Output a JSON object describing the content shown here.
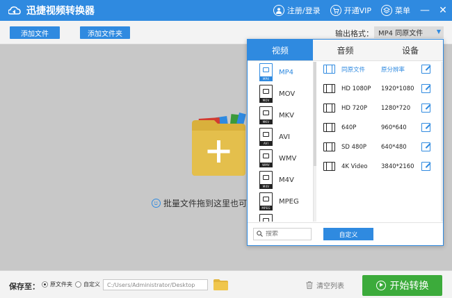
{
  "app": {
    "title": "迅捷视频转换器",
    "register_login": "注册/登录",
    "open_vip": "开通VIP",
    "menu": "菜单",
    "minimize": "—",
    "close": "✕"
  },
  "toolbar": {
    "add_file": "添加文件",
    "add_folder": "添加文件夹",
    "output_format_label": "输出格式：",
    "output_format_value": "MP4  同原文件"
  },
  "main": {
    "hint": "批量文件拖到这里也可"
  },
  "popup": {
    "tabs": [
      {
        "label": "视频",
        "active": true
      },
      {
        "label": "音频",
        "active": false
      },
      {
        "label": "设备",
        "active": false
      }
    ],
    "formats": [
      {
        "name": "MP4",
        "tag": "MP4",
        "selected": true
      },
      {
        "name": "MOV",
        "tag": "MOV",
        "selected": false
      },
      {
        "name": "MKV",
        "tag": "MKV",
        "selected": false
      },
      {
        "name": "AVI",
        "tag": "AVI",
        "selected": false
      },
      {
        "name": "WMV",
        "tag": "WMV",
        "selected": false
      },
      {
        "name": "M4V",
        "tag": "M4V",
        "selected": false
      },
      {
        "name": "MPEG",
        "tag": "MPEG",
        "selected": false
      }
    ],
    "resolutions": [
      {
        "name": "同原文件",
        "size": "原分辨率",
        "selected": true
      },
      {
        "name": "HD 1080P",
        "size": "1920*1080",
        "selected": false
      },
      {
        "name": "HD 720P",
        "size": "1280*720",
        "selected": false
      },
      {
        "name": "640P",
        "size": "960*640",
        "selected": false
      },
      {
        "name": "SD 480P",
        "size": "640*480",
        "selected": false
      },
      {
        "name": "4K Video",
        "size": "3840*2160",
        "selected": false
      }
    ],
    "search_placeholder": "搜索",
    "custom_button": "自定义"
  },
  "bottom": {
    "save_to": "保存至：",
    "option_source_folder": "原文件夹",
    "option_custom": "自定义",
    "path_value": "C:/Users/Administrator/Desktop",
    "clear_list": "清空列表",
    "start_convert": "开始转换"
  },
  "colors": {
    "accent": "#2f8ae0",
    "start_green": "#3cab3b",
    "folder_yellow": "#d9b03c"
  }
}
